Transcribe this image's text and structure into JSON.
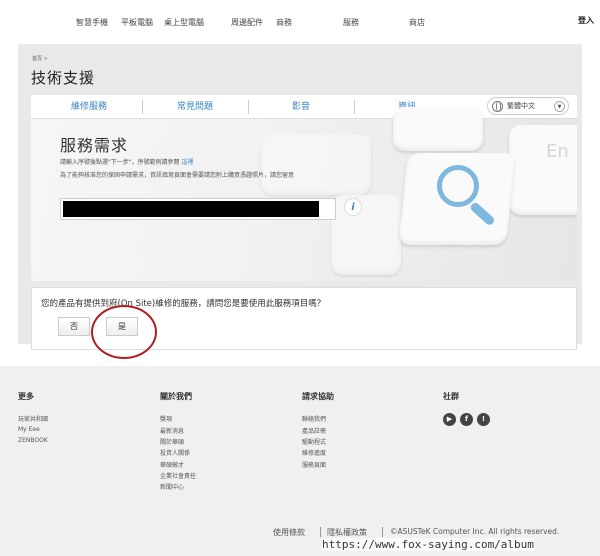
{
  "nav": {
    "items": [
      "智慧手機",
      "平板電腦",
      "桌上型電腦",
      "周邊配件",
      "商務",
      "服務",
      "商店"
    ],
    "login": "登入"
  },
  "breadcrumb": "首頁 >",
  "page_title": "技術支援",
  "tabs": [
    "維修服務",
    "常見問題",
    "影音",
    "資訊"
  ],
  "language": {
    "selected": "繁體中文"
  },
  "service": {
    "title": "服務需求",
    "line1_prefix": "請輸入序號後點選\"下一步\"，序號範例請參閱 ",
    "line1_link": "這裡",
    "line2": "為了能夠核准您的保固申請需求，資訊填寫頁面會需要請您附上購買憑證照片，請您留意",
    "info_icon": "i"
  },
  "question": {
    "text": "您的產品有提供到府(On Site)維修的服務，請問您是要使用此服務項目嗎？",
    "no_label": "否",
    "yes_label": "是"
  },
  "hero_key_letter": "En",
  "footer": {
    "col1": {
      "heading": "更多",
      "items": [
        "玩家共和國",
        "My Eee",
        "ZENBOOK"
      ]
    },
    "col2": {
      "heading": "關於我們",
      "items": [
        "獎項",
        "最新消息",
        "關於華碩",
        "投資人關係",
        "華碩徵才",
        "企業社會責任",
        "新聞中心"
      ]
    },
    "col3": {
      "heading": "請求協助",
      "items": [
        "聯絡我們",
        "產品註冊",
        "驅動程式",
        "維修進度",
        "服務頁面"
      ]
    },
    "col4": {
      "heading": "社群"
    },
    "legal": [
      "使用條款",
      "隱私權政策",
      "©ASUSTeK Computer Inc. All rights reserved."
    ]
  },
  "watermark": "https://www.fox-saying.com/album",
  "colors": {
    "accent": "#3a84c4",
    "highlight_circle": "#b01f1f"
  }
}
